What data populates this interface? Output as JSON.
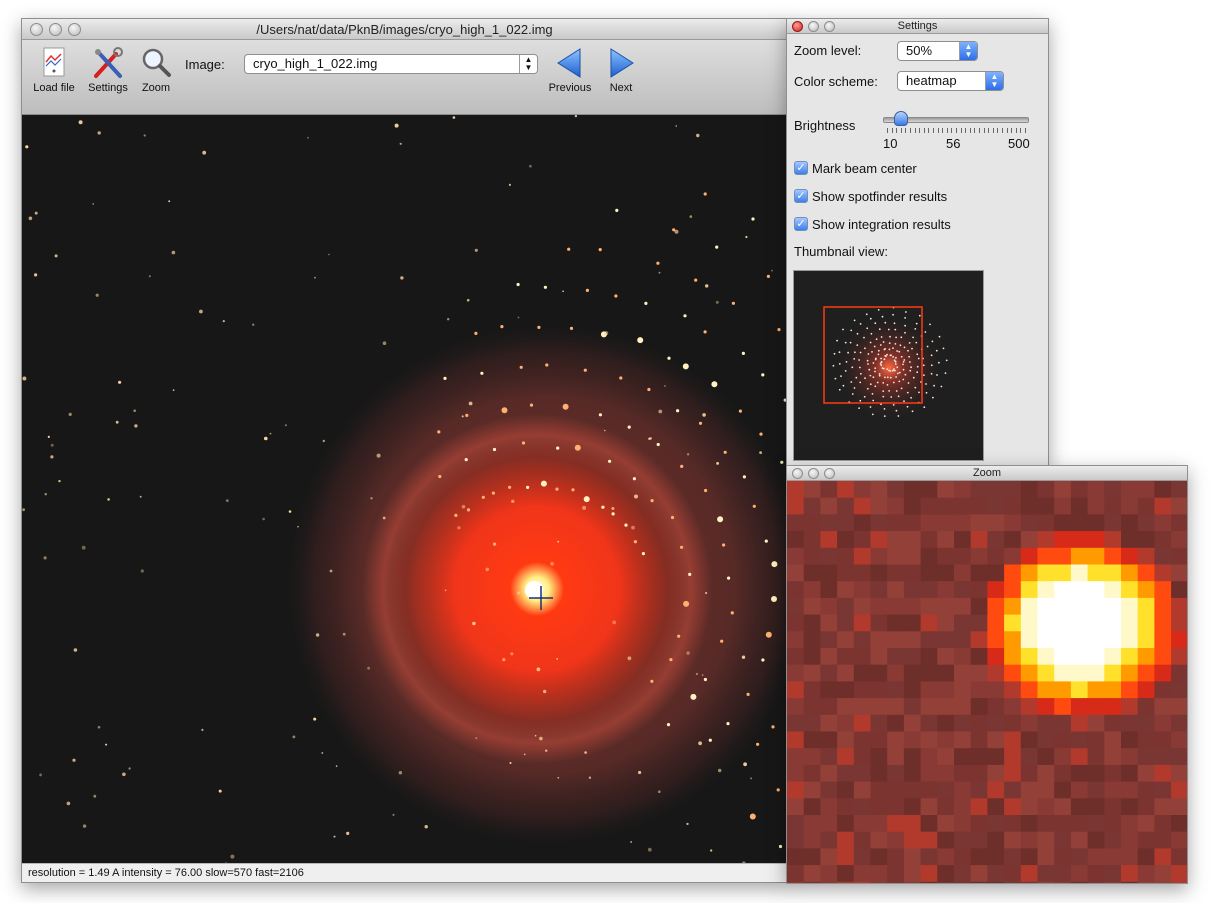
{
  "main_window": {
    "title": "/Users/nat/data/PknB/images/cryo_high_1_022.img",
    "toolbar": {
      "load_label": "Load file",
      "settings_label": "Settings",
      "zoom_label": "Zoom",
      "image_label": "Image:",
      "image_selected": "cryo_high_1_022.img",
      "previous_label": "Previous",
      "next_label": "Next"
    },
    "status": "resolution = 1.49 A  intensity = 76.00  slow=570  fast=2106"
  },
  "settings_window": {
    "title": "Settings",
    "zoom_level_label": "Zoom level:",
    "zoom_level_value": "50%",
    "color_scheme_label": "Color scheme:",
    "color_scheme_value": "heatmap",
    "brightness_label": "Brightness",
    "brightness_min": "10",
    "brightness_mid": "56",
    "brightness_max": "500",
    "brightness_value": 0.04,
    "checkboxes": [
      {
        "label": "Mark beam center",
        "checked": true
      },
      {
        "label": "Show spotfinder results",
        "checked": true
      },
      {
        "label": "Show integration results",
        "checked": true
      }
    ],
    "thumbnail_label": "Thumbnail view:"
  },
  "zoom_window": {
    "title": "Zoom"
  },
  "colors": {
    "image_background": "#171717",
    "halo": "#ff3a12",
    "thumbnail_box": "#ff3a12",
    "checkbox_accent": "#3f7ee6"
  }
}
